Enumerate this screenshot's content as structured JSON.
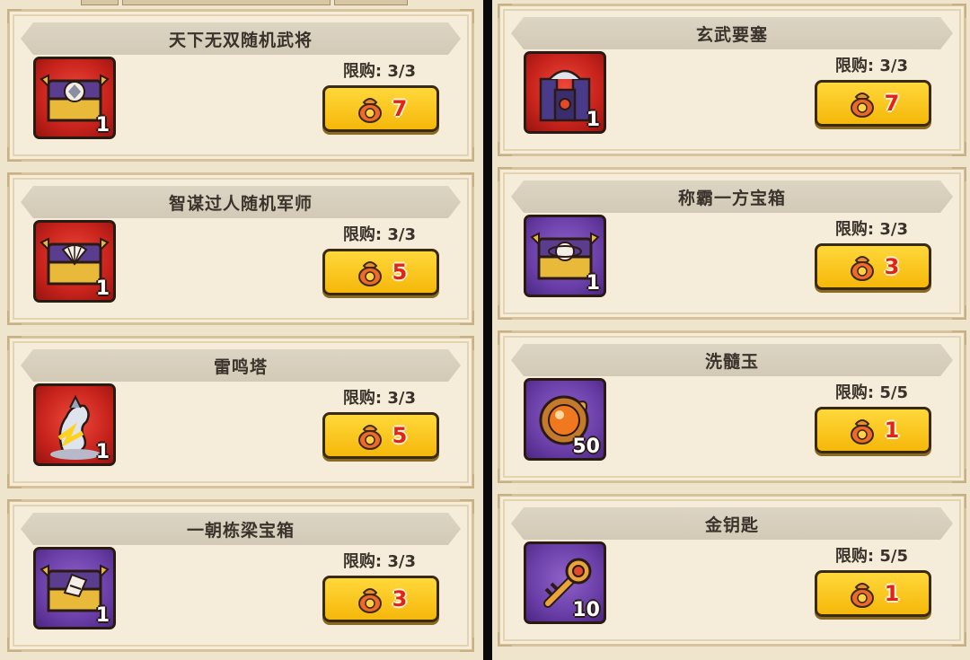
{
  "left_items": [
    {
      "name": "天下无双随机武将",
      "limit": "限购: 3/3",
      "price": "7",
      "count": "1",
      "icon": "chest-general-icon",
      "frame": "red"
    },
    {
      "name": "智谋过人随机军师",
      "limit": "限购: 3/3",
      "price": "5",
      "count": "1",
      "icon": "chest-strategist-icon",
      "frame": "red"
    },
    {
      "name": "雷鸣塔",
      "limit": "限购: 3/3",
      "price": "5",
      "count": "1",
      "icon": "thunder-tower-icon",
      "frame": "red"
    },
    {
      "name": "一朝栋梁宝箱",
      "limit": "限购: 3/3",
      "price": "3",
      "count": "1",
      "icon": "chest-pillar-icon",
      "frame": "purple"
    }
  ],
  "right_items": [
    {
      "name": "玄武要塞",
      "limit": "限购: 3/3",
      "price": "7",
      "count": "1",
      "icon": "fortress-icon",
      "frame": "red"
    },
    {
      "name": "称霸一方宝箱",
      "limit": "限购: 3/3",
      "price": "3",
      "count": "1",
      "icon": "chest-dominate-icon",
      "frame": "purple"
    },
    {
      "name": "洗髓玉",
      "limit": "限购: 5/5",
      "price": "1",
      "count": "50",
      "icon": "jade-orb-icon",
      "frame": "purple"
    },
    {
      "name": "金钥匙",
      "limit": "限购: 5/5",
      "price": "1",
      "count": "10",
      "icon": "gold-key-icon",
      "frame": "purple"
    }
  ],
  "currency_icon": "lucky-bag-icon",
  "colors": {
    "button": "#f5b70a",
    "price": "#e4221a",
    "red_frame": "#c8231c",
    "purple_frame": "#6b3fa8",
    "panel": "#f5ecd9"
  }
}
